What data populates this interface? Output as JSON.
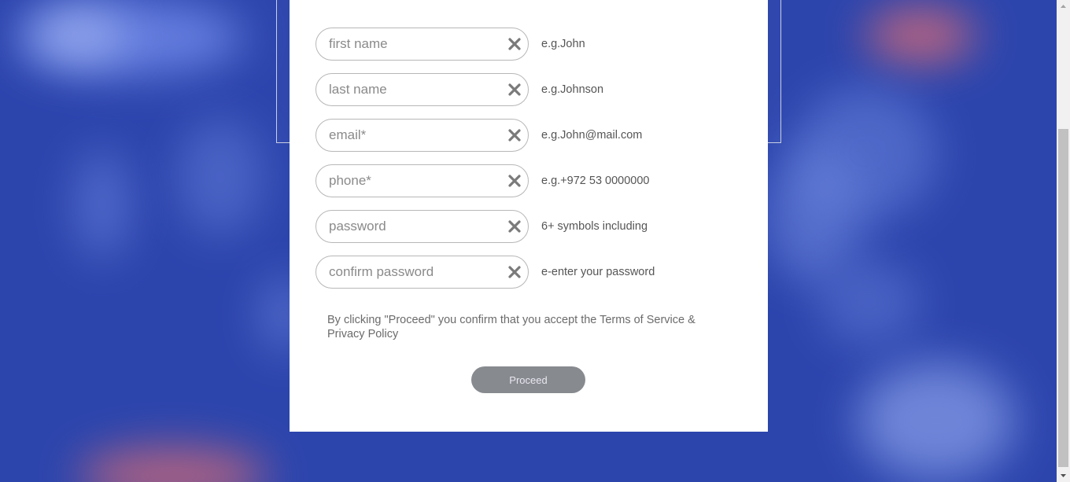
{
  "form": {
    "fields": [
      {
        "placeholder": "first name",
        "hint": "e.g.John"
      },
      {
        "placeholder": "last name",
        "hint": "e.g.Johnson"
      },
      {
        "placeholder": "email*",
        "hint": "e.g.John@mail.com"
      },
      {
        "placeholder": "phone*",
        "hint": "e.g.+972 53 0000000"
      },
      {
        "placeholder": "password",
        "hint": "6+ symbols including"
      },
      {
        "placeholder": "confirm password",
        "hint": "e-enter your password"
      }
    ],
    "terms_text": "By clicking \"Proceed\" you confirm that you accept the Terms of Service & Privacy Policy",
    "proceed_label": "Proceed",
    "clear_icon": "close-icon"
  },
  "colors": {
    "background": "#2c45ad",
    "card": "#ffffff",
    "button": "#878a8e",
    "button_text": "#e8e8f3",
    "input_border": "#b7b7b7",
    "icon": "#7a7a7a"
  }
}
